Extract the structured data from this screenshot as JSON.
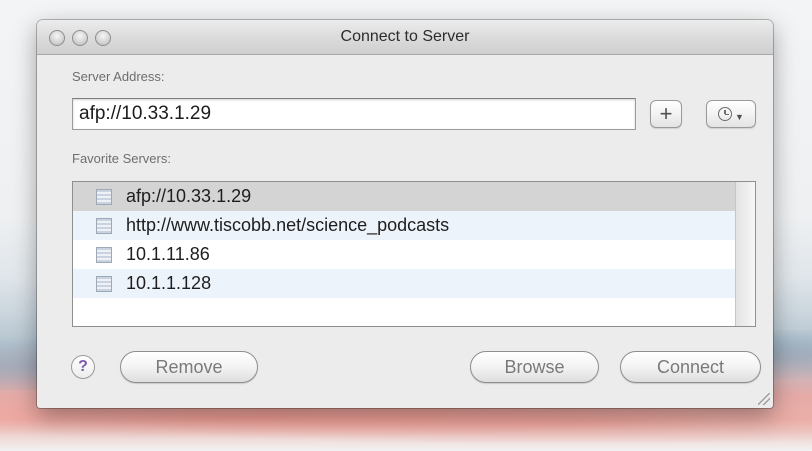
{
  "window": {
    "title": "Connect to Server"
  },
  "server_address": {
    "label": "Server Address:",
    "value": "afp://10.33.1.29"
  },
  "buttons": {
    "add": "+",
    "help": "?",
    "remove": "Remove",
    "browse": "Browse",
    "connect": "Connect"
  },
  "favorites": {
    "label": "Favorite Servers:",
    "selected_index": 0,
    "items": [
      "afp://10.33.1.29",
      "http://www.tiscobb.net/science_podcasts",
      "10.1.11.86",
      "10.1.1.128"
    ]
  },
  "icons": {
    "recent_servers": "clock-icon",
    "recent_menu": "chevron-down-icon",
    "server_item": "server-icon",
    "window_controls": [
      "close-icon",
      "minimize-icon",
      "zoom-icon"
    ],
    "resize": "resize-grip-icon"
  },
  "colors": {
    "window_bg": "#ececec",
    "selected_row": "#d4d4d4",
    "alternate_row": "#edf3fb",
    "help_glyph": "#7f5ab0"
  }
}
